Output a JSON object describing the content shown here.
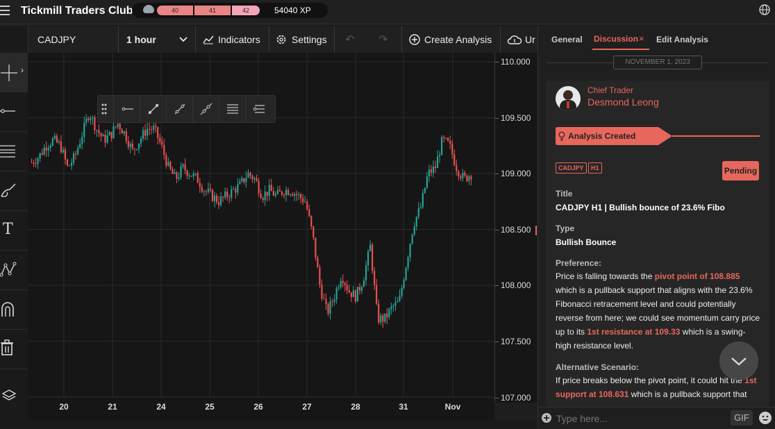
{
  "app": {
    "title": "Tickmill Traders Club",
    "xp": "54040 XP"
  },
  "xp_levels": [
    "40",
    "41",
    "42"
  ],
  "toolbar": {
    "symbol": "CADJPY",
    "timeframe": "1 hour",
    "indicators": "Indicators",
    "settings": "Settings",
    "create_analysis": "Create Analysis",
    "upload_partial": "Ur"
  },
  "chart": {
    "y_ticks": [
      "110.000",
      "109.500",
      "109.000",
      "108.500",
      "108.000",
      "107.500",
      "107.000"
    ],
    "x_ticks": [
      "20",
      "21",
      "24",
      "25",
      "26",
      "27",
      "28",
      "31",
      "Nov"
    ],
    "colors": {
      "up": "#26a69a",
      "down": "#ef5350",
      "bg": "#161616",
      "grid": "#2a2a2a"
    }
  },
  "chart_data": {
    "type": "candlestick",
    "symbol": "CADJPY",
    "timeframe": "1 hour",
    "ylim": [
      107.0,
      110.0
    ],
    "x_labels": [
      "20",
      "21",
      "24",
      "25",
      "26",
      "27",
      "28",
      "31",
      "Nov"
    ],
    "close_path": [
      109.1,
      109.15,
      109.25,
      109.3,
      109.25,
      109.05,
      109.15,
      109.35,
      109.55,
      109.4,
      109.3,
      109.35,
      109.45,
      109.35,
      109.2,
      109.3,
      109.4,
      109.4,
      109.25,
      109.05,
      108.95,
      109.05,
      109.0,
      108.95,
      108.85,
      108.8,
      108.75,
      108.8,
      108.85,
      108.9,
      109.0,
      108.95,
      108.8,
      108.85,
      108.8,
      108.85,
      108.85,
      108.8,
      108.75,
      108.45,
      108.0,
      107.75,
      107.9,
      108.1,
      107.95,
      107.9,
      108.05,
      108.35,
      107.7,
      107.7,
      107.8,
      107.85,
      108.2,
      108.55,
      108.7,
      109.0,
      109.05,
      109.3,
      109.25,
      109.05,
      108.95,
      109.0
    ]
  },
  "panel": {
    "tabs": [
      "General",
      "Discussion",
      "Edit Analysis"
    ],
    "date": "NOVEMBER 1, 2023",
    "author_role": "Chief Trader",
    "author_name": "Desmond Leong",
    "status_banner": "Analysis Created",
    "tags": [
      "CADJPY",
      "H1"
    ],
    "status": "Pending",
    "title_label": "Title",
    "title_value": "CADJPY H1 | Bullish bounce of 23.6% Fibo",
    "type_label": "Type",
    "type_value": "Bullish Bounce",
    "pref_label": "Preference:",
    "pref_text_1": "Price is falling towards the ",
    "pref_hl_1": "pivot point of 108.885",
    "pref_text_2": " which is a pullback support that aligns with the 23.6% Fibonacci retracement level and could potentially reverse from here; we could see momentum carry price up to its ",
    "pref_hl_2": "1st resistance at 109.33",
    "pref_text_3": " which is a swing-high resistance level.",
    "alt_label": "Alternative Scenario:",
    "alt_text_1": "If price breaks below the pivot point, it could hit the ",
    "alt_hl_1": "1st support at 108.631",
    "alt_text_2": " which is a pullback support that",
    "input_placeholder": "Type here...",
    "gif": "GIF"
  }
}
